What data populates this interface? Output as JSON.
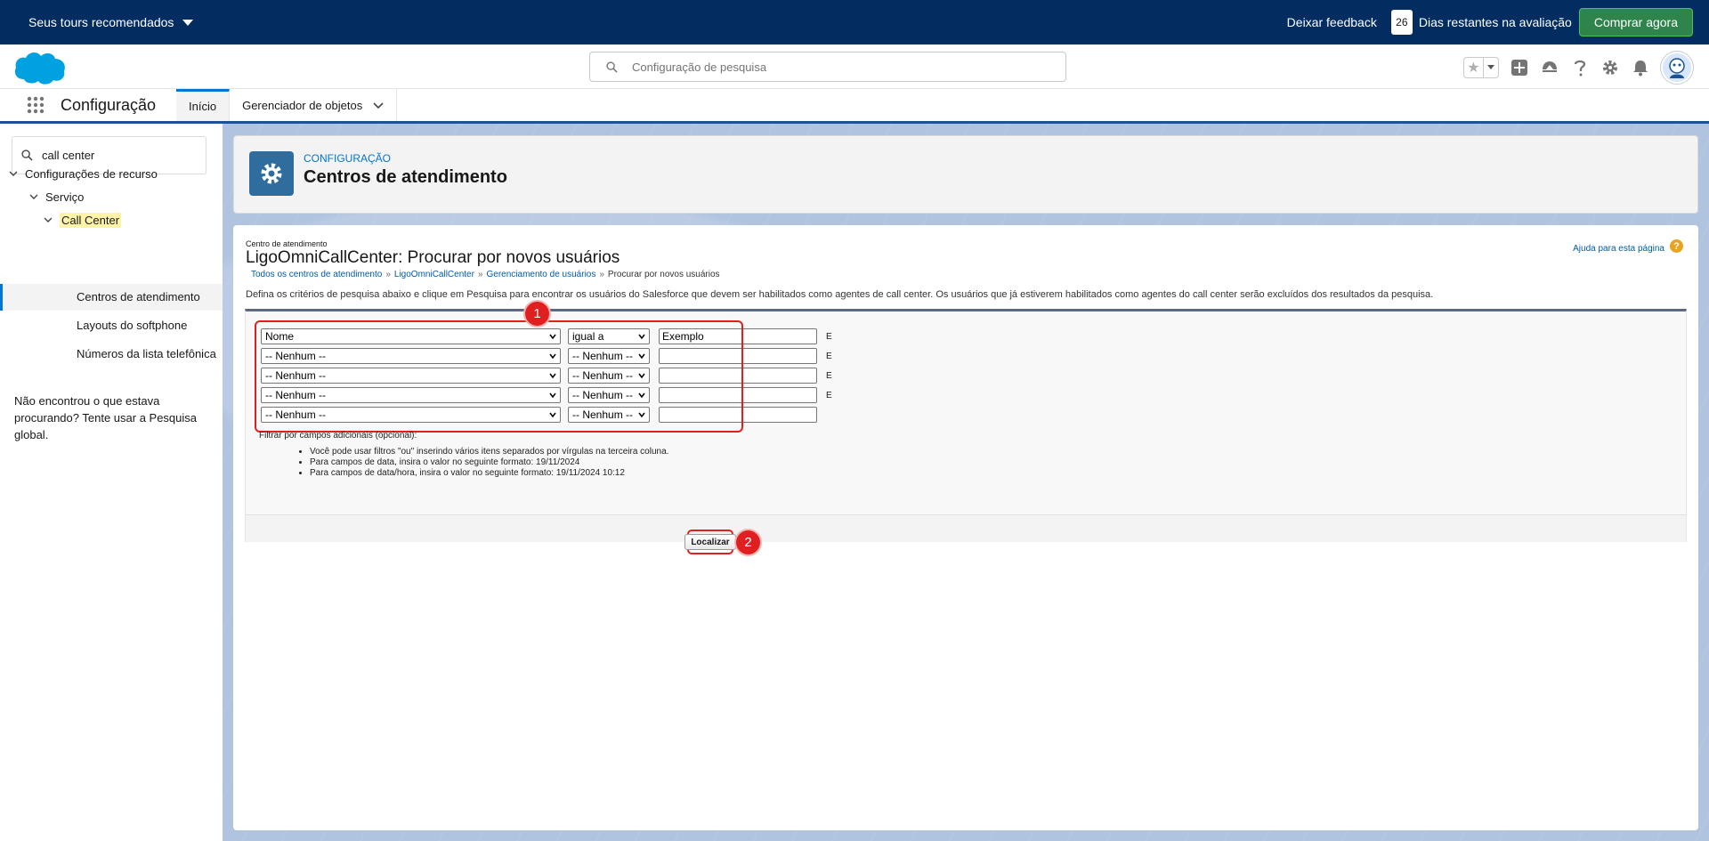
{
  "trialbar": {
    "tours_label": "Seus tours recomendados",
    "feedback_label": "Deixar feedback",
    "days_count": "26",
    "days_text": "Dias restantes na avaliação",
    "buy_label": "Comprar agora"
  },
  "header": {
    "search_placeholder": "Configuração de pesquisa"
  },
  "appnav": {
    "app_name": "Configuração",
    "tabs": [
      {
        "label": "Início"
      },
      {
        "label": "Gerenciador de objetos"
      }
    ]
  },
  "sidebar": {
    "search_value": "call center",
    "tree": {
      "root": "Configurações de recurso",
      "level1": "Serviço",
      "level2": "Call Center",
      "items": [
        "Centros de atendimento",
        "Layouts do softphone",
        "Números da lista telefônica"
      ]
    },
    "help_text": "Não encontrou o que estava procurando? Tente usar a Pesquisa global."
  },
  "page_header": {
    "eyebrow": "CONFIGURAÇÃO",
    "title": "Centros de atendimento"
  },
  "content": {
    "small_label": "Centro de atendimento",
    "title": "LigoOmniCallCenter: Procurar por novos usuários",
    "help_link": "Ajuda para esta página",
    "breadcrumbs": [
      "Todos os centros de atendimento",
      "LigoOmniCallCenter",
      "Gerenciamento de usuários"
    ],
    "breadcrumb_current": "Procurar por novos usuários",
    "description": "Defina os critérios de pesquisa abaixo e clique em Pesquisa para encontrar os usuários do Salesforce que devem ser habilitados como agentes de call center. Os usuários que já estiverem habilitados como agentes do call center serão excluídos dos resultados da pesquisa.",
    "filters": [
      {
        "field": "Nome",
        "operator": "igual a",
        "value": "Exemplo",
        "conj": "E"
      },
      {
        "field": "-- Nenhum --",
        "operator": "-- Nenhum --",
        "value": "",
        "conj": "E"
      },
      {
        "field": "-- Nenhum --",
        "operator": "-- Nenhum --",
        "value": "",
        "conj": "E"
      },
      {
        "field": "-- Nenhum --",
        "operator": "-- Nenhum --",
        "value": "",
        "conj": "E"
      },
      {
        "field": "-- Nenhum --",
        "operator": "-- Nenhum --",
        "value": "",
        "conj": ""
      }
    ],
    "optional_label": "Filtrar por campos adicionais (opcional):",
    "tips": [
      "Você pode usar filtros \"ou\" inserindo vários itens separados por vírgulas na terceira coluna.",
      "Para campos de data, insira o valor no seguinte formato: 19/11/2024",
      "Para campos de data/hora, insira o valor no seguinte formato: 19/11/2024 10:12"
    ],
    "find_label": "Localizar"
  },
  "annotations": {
    "badge1": "1",
    "badge2": "2",
    "color": "#e02020"
  },
  "colors": {
    "trialbar_bg": "#032d60",
    "buy_btn": "#2e844a",
    "brand_blue": "#0176d3",
    "page_icon": "#2f6d9e"
  }
}
